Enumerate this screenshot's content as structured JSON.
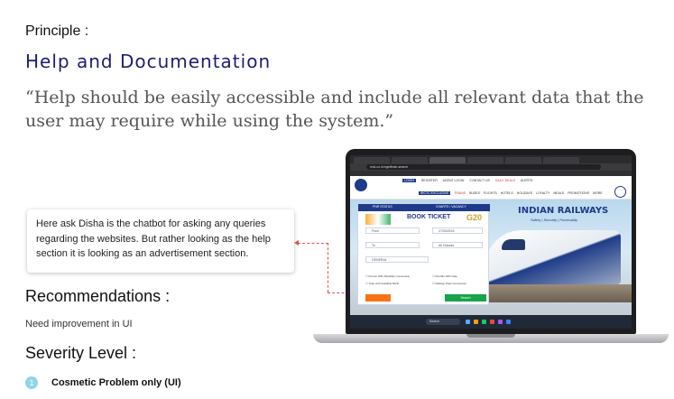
{
  "principle_label": "Principle :",
  "heading": "Help and Documentation",
  "quote": "“Help should be easily accessible and include all relevant data that the user may require while using the system.”",
  "callout_text": "Here ask Disha is the chatbot for asking any queries regarding the websites. But rather looking as the help section it is looking as an advertisement section.",
  "recommendations": {
    "title": "Recommendations :",
    "text": "Need improvement in UI"
  },
  "severity": {
    "title": "Severity Level :",
    "number": "1",
    "text": "Cosmetic Problem only (UI)"
  },
  "colors": {
    "heading": "#1c1f6e",
    "annotation": "#e05050",
    "severity_badge": "#8fd6e6"
  },
  "screenshot": {
    "address": "irctc.co.in/nget/train-search",
    "nav_top": [
      "LOGIN",
      "REGISTER",
      "AGENT LOGIN",
      "CONTACT US",
      "DAILY DEALS",
      "ALERTS"
    ],
    "nav_main": [
      "IRCTC EXCLUSIVE",
      "TRAINS",
      "BUSES",
      "FLIGHTS",
      "HOTELS",
      "HOLIDAYS",
      "LOYALTY",
      "MEALS",
      "PROMOTIONS",
      "MORE"
    ],
    "hero_title": "INDIAN RAILWAYS",
    "hero_sub": "Safety | Security | Punctuality",
    "pnr_tab": "PNR STATUS",
    "charts_tab": "CHARTS / VACANCY",
    "book_title": "BOOK TICKET",
    "g20": "G20",
    "from": "From",
    "to": "To",
    "date": "27/03/2024",
    "class": "All Classes",
    "quota": "GENERAL",
    "search_button": "Search",
    "task_search": "Search"
  }
}
